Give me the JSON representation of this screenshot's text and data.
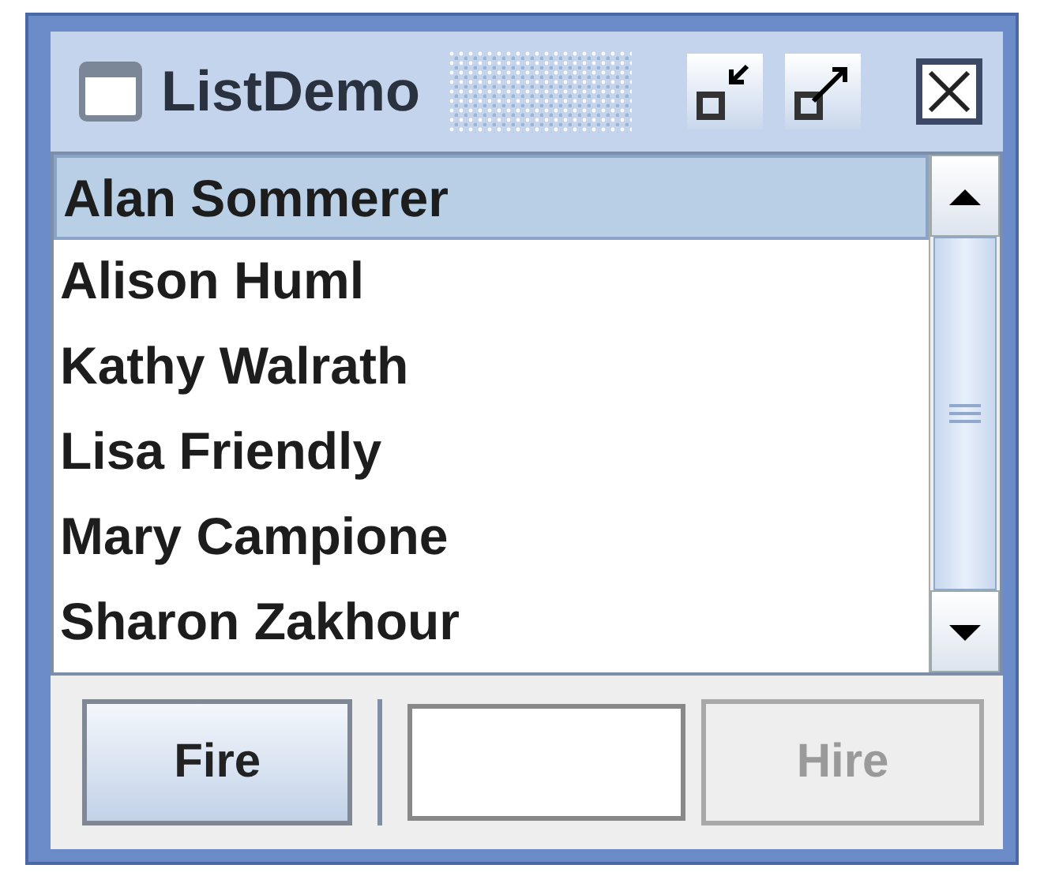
{
  "window": {
    "title": "ListDemo"
  },
  "list": {
    "items": [
      {
        "name": "Alan Sommerer",
        "selected": true
      },
      {
        "name": "Alison Huml",
        "selected": false
      },
      {
        "name": "Kathy Walrath",
        "selected": false
      },
      {
        "name": "Lisa Friendly",
        "selected": false
      },
      {
        "name": "Mary Campione",
        "selected": false
      },
      {
        "name": "Sharon Zakhour",
        "selected": false
      }
    ]
  },
  "fire_button": {
    "label": "Fire",
    "disabled": false
  },
  "hire_button": {
    "label": "Hire",
    "disabled": true
  }
}
